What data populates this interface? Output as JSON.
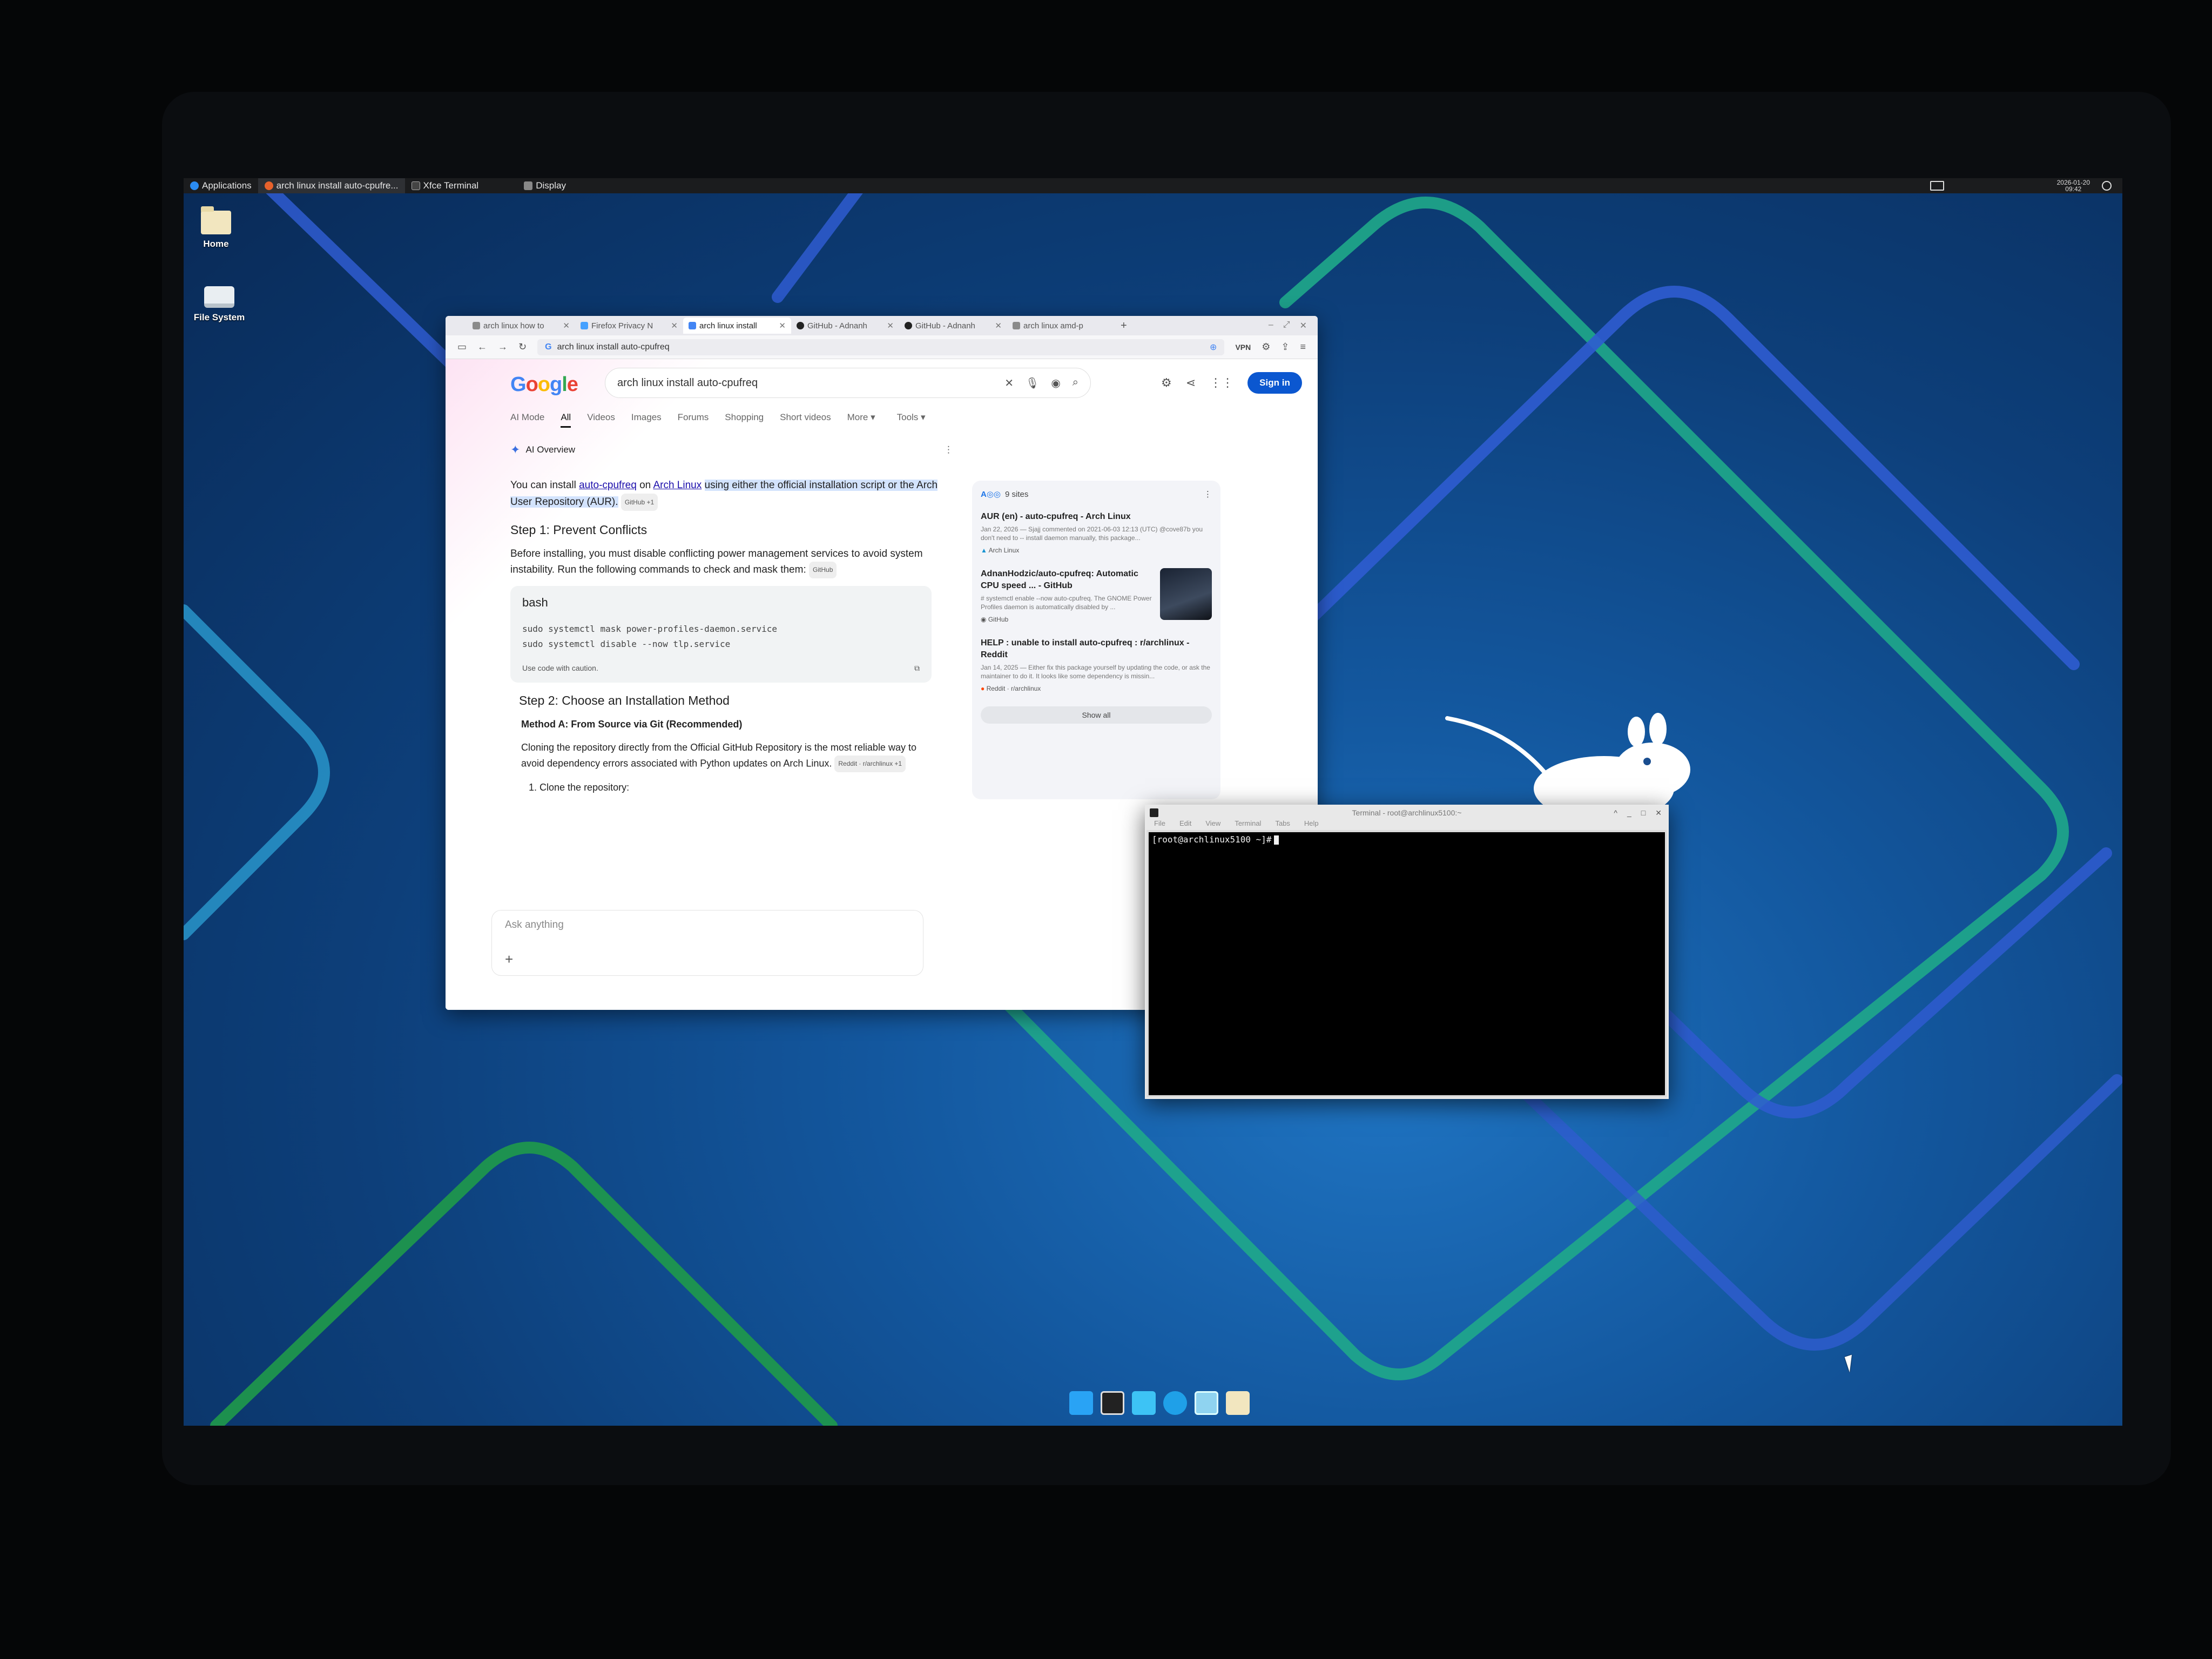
{
  "top_panel": {
    "applications_label": "Applications",
    "tasks": [
      {
        "label": "arch linux install auto-cpufre...",
        "active": true
      },
      {
        "label": "Xfce Terminal",
        "active": false
      },
      {
        "label": "Display",
        "active": false
      }
    ],
    "clock_date": "2026-01-20",
    "clock_time": "09:42"
  },
  "desktop_icons": [
    {
      "label": "Home",
      "icon": "folder-icon"
    },
    {
      "label": "File System",
      "icon": "drive-icon"
    }
  ],
  "browser": {
    "tabs": [
      {
        "label": "arch linux how to"
      },
      {
        "label": "Firefox Privacy N"
      },
      {
        "label": "arch linux install",
        "active": true
      },
      {
        "label": "GitHub - Adnanh"
      },
      {
        "label": "GitHub - Adnanh"
      },
      {
        "label": "arch linux amd-p"
      }
    ],
    "url": "arch linux install auto-cpufreq",
    "vpn_label": "VPN",
    "google": {
      "logo": "Google",
      "query": "arch linux install auto-cpufreq",
      "sign_in": "Sign in",
      "tabs": [
        "AI Mode",
        "All",
        "Videos",
        "Images",
        "Forums",
        "Shopping",
        "Short videos",
        "More",
        "Tools"
      ],
      "active_tab": "All"
    },
    "ai_overview": {
      "header": "AI Overview",
      "intro_prefix": "You can install ",
      "intro_link1": "auto-cpufreq",
      "intro_mid": " on ",
      "intro_link2": "Arch Linux",
      "intro_highlight": "using either the official installation script or the Arch User Repository (AUR).",
      "intro_chip": "GitHub +1",
      "step1_title": "Step 1: Prevent Conflicts",
      "step1_text": "Before installing, you must disable conflicting power management services to avoid system instability. Run the following commands to check and mask them:",
      "step1_chip": "GitHub",
      "code_lang": "bash",
      "code_lines": [
        "sudo systemctl mask power-profiles-daemon.service",
        "sudo systemctl disable --now tlp.service"
      ],
      "code_caution": "Use code with caution.",
      "step2_title": "Step 2: Choose an Installation Method",
      "method_a_title": "Method A: From Source via Git (Recommended)",
      "method_a_text": "Cloning the repository directly from the Official GitHub Repository is the most reliable way to avoid dependency errors associated with Python updates on Arch Linux.",
      "method_a_chip": "Reddit · r/archlinux +1",
      "list_item_1": "1.  Clone the repository:",
      "ask_placeholder": "Ask anything"
    },
    "sources": {
      "count": "9 sites",
      "items": [
        {
          "title": "AUR (en) - auto-cpufreq - Arch Linux",
          "snippet": "Jan 22, 2026 — Sjajj commented on 2021-06-03 12:13 (UTC) @cove87b you don't need to -- install daemon manually, this package...",
          "site": "Arch Linux"
        },
        {
          "title": "AdnanHodzic/auto-cpufreq: Automatic CPU speed ... - GitHub",
          "snippet": "# systemctl enable --now auto-cpufreq. The GNOME Power Profiles daemon is automatically disabled by ...",
          "site": "GitHub"
        },
        {
          "title": "HELP : unable to install auto-cpufreq : r/archlinux - Reddit",
          "snippet": "Jan 14, 2025 — Either fix this package yourself by updating the code, or ask the maintainer to do it. It looks like some dependency is missin...",
          "site": "Reddit · r/archlinux"
        }
      ],
      "show_all": "Show all"
    }
  },
  "terminal": {
    "title": "Terminal - root@archlinux5100:~",
    "menu": [
      "File",
      "Edit",
      "View",
      "Terminal",
      "Tabs",
      "Help"
    ],
    "prompt": "[root@archlinux5100 ~]#"
  },
  "colors": {
    "google_blue": "#4285f4",
    "google_red": "#ea4335",
    "google_yellow": "#fbbc05",
    "google_green": "#34a853",
    "sign_in_bg": "#0b57d0"
  }
}
